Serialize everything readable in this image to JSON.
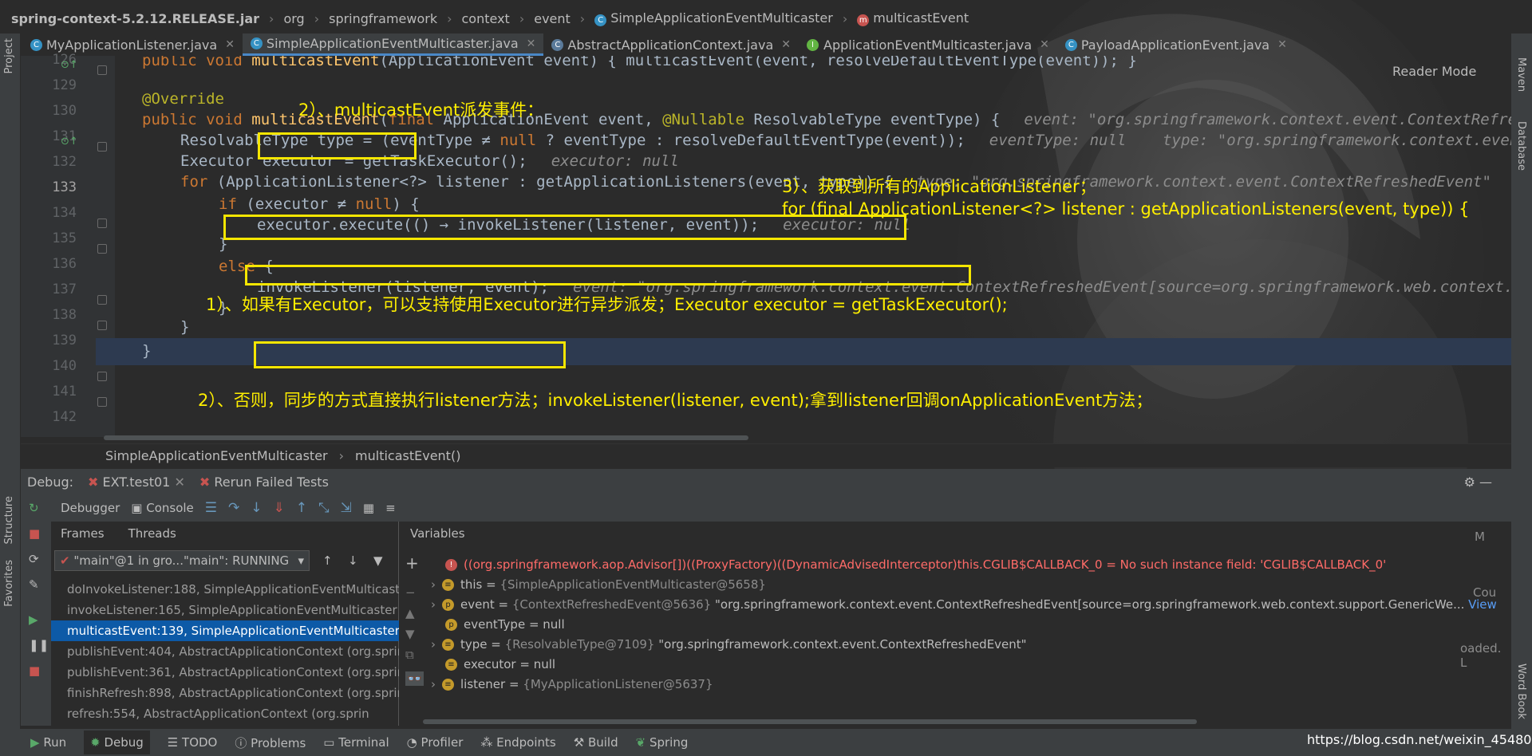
{
  "breadcrumb": {
    "jar": "spring-context-5.2.12.RELEASE.jar",
    "parts": [
      "org",
      "springframework",
      "context",
      "event"
    ],
    "class_name": "SimpleApplicationEventMulticaster",
    "method_name": "multicastEvent"
  },
  "tabs": [
    {
      "label": "MyApplicationListener.java",
      "icon": "class-icon"
    },
    {
      "label": "SimpleApplicationEventMulticaster.java",
      "icon": "class-icon",
      "active": true
    },
    {
      "label": "AbstractApplicationContext.java",
      "icon": "abstract-class-icon"
    },
    {
      "label": "ApplicationEventMulticaster.java",
      "icon": "interface-icon"
    },
    {
      "label": "PayloadApplicationEvent.java",
      "icon": "class-icon"
    }
  ],
  "side_left": {
    "project": "Project",
    "structure": "Structure",
    "favorites": "Favorites"
  },
  "side_right": {
    "maven": "Maven",
    "database": "Database",
    "word_book": "Word Book"
  },
  "reader_mode": "Reader Mode",
  "line_numbers": [
    "126",
    "129",
    "130",
    "131",
    "132",
    "133",
    "134",
    "135",
    "136",
    "137",
    "138",
    "139",
    "140",
    "141",
    "142"
  ],
  "code": {
    "l126": {
      "kw": "public void ",
      "fn": "multicastEvent",
      "rest": "(ApplicationEvent event) { multicastEvent(event, resolveDefaultEventType(event)); }"
    },
    "l130": "@Override",
    "l131": {
      "kw": "public void ",
      "fn": "multicastEvent",
      "p1": "(",
      "kw2": "final ",
      "rest": "ApplicationEvent event, ",
      "an": "@Nullable ",
      "rest2": "ResolvableType eventType) {",
      "hint": "event: \"org.springframework.context.event.ContextRefreshedEvent"
    },
    "l132": {
      "text": "ResolvableType type = (eventType ≠ ",
      "kw": "null",
      "text2": " ? eventType : resolveDefaultEventType(event));",
      "hint": "eventType: null    type: \"org.springframework.context.event.ContextRefreshedEvent\""
    },
    "l133": {
      "text": "Executor executor = getTaskExecutor();",
      "hint": "executor: null"
    },
    "l134": {
      "kw": "for ",
      "text": "(ApplicationListener<?> listener : getApplicationListeners(event, type)) {",
      "hint": "type: \"org.springframework.context.event.ContextRefreshedEvent\""
    },
    "l135": {
      "kw": "if ",
      "text": "(executor ≠ ",
      "kw2": "null",
      "text2": ") {"
    },
    "l136": {
      "text": "executor.execute(() → invokeListener(listener, event));",
      "hint": "executor: null"
    },
    "l137": "}",
    "l138": {
      "kw": "else ",
      "text": "{"
    },
    "l139": {
      "text": "invokeListener(listener, event);",
      "hint": "event: \"org.springframework.context.event.ContextRefreshedEvent[source=org.springframework.web.context.support.GenericWebApplicationContext"
    },
    "l140": "}",
    "l141": "}",
    "l142": "}"
  },
  "annotations": {
    "a2": "2）、multicastEvent派发事件：",
    "a3_line1": "3）、获取到所有的ApplicationListener；",
    "a3_line2": "for (final ApplicationListener<?> listener : getApplicationListeners(event, type)) {",
    "a1": "1）、如果有Executor，可以支持使用Executor进行异步派发；Executor executor = getTaskExecutor();",
    "a2b": "2）、否则，同步的方式直接执行listener方法；invokeListener(listener, event);拿到listener回调onApplicationEvent方法；"
  },
  "editor_breadcrumb": {
    "class_name": "SimpleApplicationEventMulticaster",
    "method": "multicastEvent()"
  },
  "debug": {
    "label": "Debug:",
    "sessions": [
      "EXT.test01",
      "Rerun Failed Tests"
    ],
    "debugger_tab": "Debugger",
    "console_tab": "Console",
    "frames_tab": "Frames",
    "threads_tab": "Threads",
    "variables_title": "Variables",
    "thread": "\"main\"@1 in gro...\"main\": RUNNING",
    "frames": [
      {
        "method": "doInvokeListener:188, ",
        "cls": "SimpleApplicationEventMulticaster"
      },
      {
        "method": "invokeListener:165, ",
        "cls": "SimpleApplicationEventMulticaster"
      },
      {
        "method": "multicastEvent:139, ",
        "cls": "SimpleApplicationEventMulticaster (",
        "selected": true
      },
      {
        "method": "publishEvent:404, ",
        "cls": "AbstractApplicationContext (org.sprin"
      },
      {
        "method": "publishEvent:361, ",
        "cls": "AbstractApplicationContext (org.sprin"
      },
      {
        "method": "finishRefresh:898, ",
        "cls": "AbstractApplicationContext (org.sprin"
      },
      {
        "method": "refresh:554, ",
        "cls": "AbstractApplicationContext (org.sprin"
      }
    ],
    "variables": [
      {
        "text": "((org.springframework.aop.Advisor[])((ProxyFactory)((DynamicAdvisedInterceptor)this.CGLIB$CALLBACK_0 = No such instance field: 'CGLIB$CALLBACK_0'",
        "type": "error"
      },
      {
        "name": "this",
        "value": "{SimpleApplicationEventMulticaster@5658}",
        "expandable": true
      },
      {
        "name": "event",
        "value": "{ContextRefreshedEvent@5636}",
        "extra": " \"org.springframework.context.event.ContextRefreshedEvent[source=org.springframework.web.context.support.GenericWe...",
        "link": " View",
        "expandable": true
      },
      {
        "name": "eventType",
        "value": "null"
      },
      {
        "name": "type",
        "value": "{ResolvableType@7109}",
        "extra": " \"org.springframework.context.event.ContextRefreshedEvent\"",
        "expandable": true
      },
      {
        "name": "executor",
        "value": "null"
      },
      {
        "name": "listener",
        "value": "{MyApplicationListener@5637}",
        "expandable": true
      }
    ],
    "right_partial": {
      "cou": "Cou",
      "loaded": "oaded. L",
      "m": "M"
    }
  },
  "bottom_tools": [
    "Run",
    "Debug",
    "TODO",
    "Problems",
    "Terminal",
    "Profiler",
    "Endpoints",
    "Build",
    "Spring"
  ],
  "watermark": "https://blog.csdn.net/weixin_45480785",
  "colors": {
    "annotation": "#ffef00",
    "box": "#f5e600",
    "keyword": "#cc7832",
    "function": "#ffc66d",
    "selected_frame": "#0d5aa7"
  }
}
